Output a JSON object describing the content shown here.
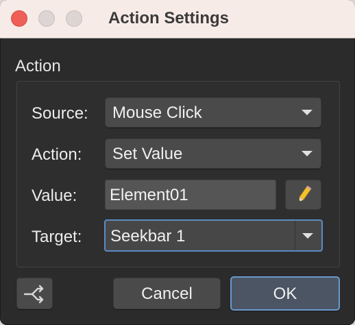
{
  "window": {
    "title": "Action Settings"
  },
  "section": {
    "label": "Action"
  },
  "fields": {
    "source_label": "Source:",
    "source_value": "Mouse Click",
    "action_label": "Action:",
    "action_value": "Set Value",
    "value_label": "Value:",
    "value_text": "Element01",
    "target_label": "Target:",
    "target_value": "Seekbar 1"
  },
  "buttons": {
    "cancel": "Cancel",
    "ok": "OK"
  },
  "icons": {
    "edit": "pencil-icon",
    "share": "branch-arrow-icon"
  },
  "colors": {
    "accent": "#5b8cc4",
    "close": "#ee5f57",
    "pencil": "#f2c12e"
  }
}
